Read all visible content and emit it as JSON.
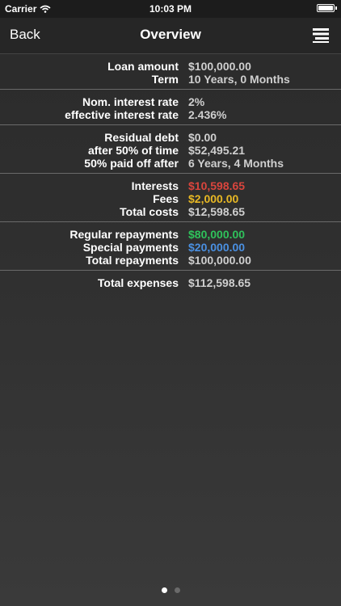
{
  "status_bar": {
    "carrier": "Carrier",
    "time": "10:03 PM",
    "icons": [
      "wifi-icon",
      "battery-icon"
    ]
  },
  "nav": {
    "back_label": "Back",
    "title": "Overview",
    "menu_icon": "menu-icon"
  },
  "sections": [
    {
      "rows": [
        {
          "label": "Loan amount",
          "value": "$100,000.00",
          "color": "#cfcfcf"
        },
        {
          "label": "Term",
          "value": "10 Years, 0 Months",
          "color": "#cfcfcf"
        }
      ]
    },
    {
      "rows": [
        {
          "label": "Nom. interest rate",
          "value": "2%",
          "color": "#cfcfcf"
        },
        {
          "label": "effective interest rate",
          "value": "2.436%",
          "color": "#cfcfcf"
        }
      ]
    },
    {
      "rows": [
        {
          "label": "Residual debt",
          "value": "$0.00",
          "color": "#cfcfcf"
        },
        {
          "label": "after 50% of time",
          "value": "$52,495.21",
          "color": "#cfcfcf"
        },
        {
          "label": "50% paid off after",
          "value": "6 Years, 4 Months",
          "color": "#cfcfcf"
        }
      ]
    },
    {
      "rows": [
        {
          "label": "Interests",
          "value": "$10,598.65",
          "color": "#d9453d"
        },
        {
          "label": "Fees",
          "value": "$2,000.00",
          "color": "#e8b824"
        },
        {
          "label": "Total costs",
          "value": "$12,598.65",
          "color": "#cfcfcf"
        }
      ]
    },
    {
      "rows": [
        {
          "label": "Regular repayments",
          "value": "$80,000.00",
          "color": "#2fc25b"
        },
        {
          "label": "Special payments",
          "value": "$20,000.00",
          "color": "#4a90e2"
        },
        {
          "label": "Total repayments",
          "value": "$100,000.00",
          "color": "#cfcfcf"
        }
      ]
    },
    {
      "rows": [
        {
          "label": "Total expenses",
          "value": "$112,598.65",
          "color": "#cfcfcf"
        }
      ]
    }
  ],
  "pagination": {
    "total_pages": 2,
    "current_page": 1
  }
}
